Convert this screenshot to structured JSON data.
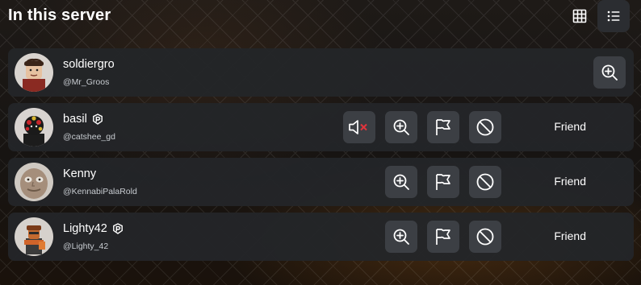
{
  "header": {
    "title": "In this server",
    "view_grid_icon": "grid-view-icon",
    "view_list_icon": "list-view-icon",
    "active_view": "list"
  },
  "players": [
    {
      "display_name": "soldiergro",
      "username": "@Mr_Groos",
      "premium": false,
      "is_self": true,
      "muted": false,
      "friend_label": ""
    },
    {
      "display_name": "basil",
      "username": "@catshee_gd",
      "premium": true,
      "is_self": false,
      "muted": true,
      "friend_label": "Friend"
    },
    {
      "display_name": "Kenny",
      "username": "@KennabiPalaRold",
      "premium": false,
      "is_self": false,
      "muted": false,
      "friend_label": "Friend"
    },
    {
      "display_name": "Lighty42",
      "username": "@Lighty_42",
      "premium": true,
      "is_self": false,
      "muted": false,
      "friend_label": "Friend"
    }
  ],
  "icons": {
    "inspect": "zoom-in-icon",
    "report": "flag-icon",
    "block": "block-icon",
    "mute": "speaker-muted-icon",
    "premium": "premium-badge-icon"
  },
  "colors": {
    "row_bg": "#232529",
    "button_bg": "#3c3f44",
    "mute_x": "#e0343c",
    "text": "#ffffff"
  }
}
